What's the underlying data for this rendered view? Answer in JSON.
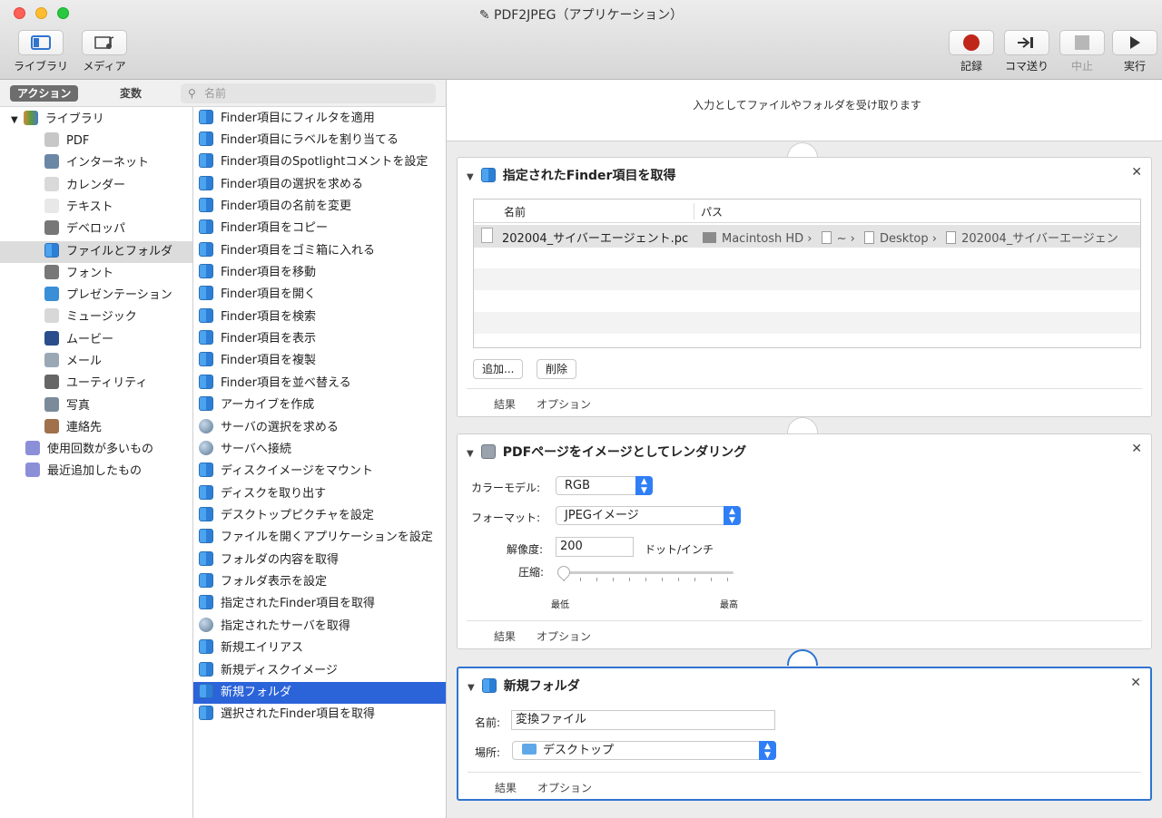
{
  "window": {
    "title": "PDF2JPEG（アプリケーション）"
  },
  "toolbar": {
    "library_label": "ライブラリ",
    "media_label": "メディア",
    "record_label": "記録",
    "step_label": "コマ送り",
    "stop_label": "中止",
    "run_label": "実行"
  },
  "search": {
    "actions_tab": "アクション",
    "variables_tab": "変数",
    "placeholder": "名前"
  },
  "library": {
    "root": "ライブラリ",
    "items": [
      "PDF",
      "インターネット",
      "カレンダー",
      "テキスト",
      "デベロッパ",
      "ファイルとフォルダ",
      "フォント",
      "プレゼンテーション",
      "ミュージック",
      "ムービー",
      "メール",
      "ユーティリティ",
      "写真",
      "連絡先"
    ],
    "selected": "ファイルとフォルダ",
    "smart": [
      "使用回数が多いもの",
      "最近追加したもの"
    ]
  },
  "actions": {
    "items": [
      "Finder項目にフィルタを適用",
      "Finder項目にラベルを割り当てる",
      "Finder項目のSpotlightコメントを設定",
      "Finder項目の選択を求める",
      "Finder項目の名前を変更",
      "Finder項目をコピー",
      "Finder項目をゴミ箱に入れる",
      "Finder項目を移動",
      "Finder項目を開く",
      "Finder項目を検索",
      "Finder項目を表示",
      "Finder項目を複製",
      "Finder項目を並べ替える",
      "アーカイブを作成",
      "サーバの選択を求める",
      "サーバへ接続",
      "ディスクイメージをマウント",
      "ディスクを取り出す",
      "デスクトップピクチャを設定",
      "ファイルを開くアプリケーションを設定",
      "フォルダの内容を取得",
      "フォルダ表示を設定",
      "指定されたFinder項目を取得",
      "指定されたサーバを取得",
      "新規エイリアス",
      "新規ディスクイメージ",
      "新規フォルダ",
      "選択されたFinder項目を取得"
    ],
    "selected": "新規フォルダ"
  },
  "workflow": {
    "hint": "入力としてファイルやフォルダを受け取ります",
    "card1": {
      "title": "指定されたFinder項目を取得",
      "col_name": "名前",
      "col_path": "パス",
      "file_name": "202004_サイバーエージェント.pc",
      "path": [
        "Macintosh HD",
        "~",
        "Desktop",
        "202004_サイバーエージェン"
      ],
      "add_btn": "追加...",
      "delete_btn": "削除",
      "results": "結果",
      "options": "オプション"
    },
    "card2": {
      "title": "PDFページをイメージとしてレンダリング",
      "color_label": "カラーモデル:",
      "color_value": "RGB",
      "format_label": "フォーマット:",
      "format_value": "JPEGイメージ",
      "res_label": "解像度:",
      "res_value": "200",
      "res_unit": "ドット/インチ",
      "comp_label": "圧縮:",
      "comp_min": "最低",
      "comp_max": "最高",
      "compression_level": 0.0,
      "results": "結果",
      "options": "オプション"
    },
    "card3": {
      "title": "新規フォルダ",
      "name_label": "名前:",
      "name_value": "変換ファイル",
      "where_label": "場所:",
      "where_value": "デスクトップ",
      "results": "結果",
      "options": "オプション"
    }
  },
  "colors": {
    "accent": "#2f74d0",
    "selection": "#2b63d9",
    "record": "#c0251a"
  }
}
